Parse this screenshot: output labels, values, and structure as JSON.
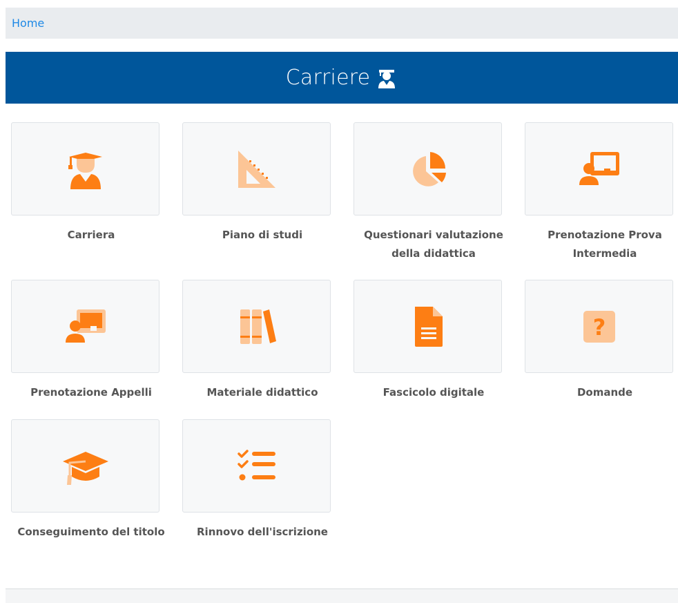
{
  "breadcrumb": {
    "home": "Home"
  },
  "header": {
    "title": "Carriere",
    "icon": "graduate-student-icon"
  },
  "colors": {
    "accent": "#fd7e14",
    "accent_light": "#fcc596",
    "header": "#00569b",
    "link": "#1e88e5"
  },
  "tiles": [
    {
      "label": "Carriera",
      "icon": "graduate-student-icon"
    },
    {
      "label": "Piano di studi",
      "icon": "set-square-icon"
    },
    {
      "label": "Questionari valutazione della didattica",
      "icon": "pie-chart-icon"
    },
    {
      "label": "Prenotazione Prova Intermedia",
      "icon": "teacher-board-icon"
    },
    {
      "label": "Prenotazione Appelli",
      "icon": "teacher-board-light-icon"
    },
    {
      "label": "Materiale didattico",
      "icon": "books-icon"
    },
    {
      "label": "Fascicolo digitale",
      "icon": "document-icon"
    },
    {
      "label": "Domande",
      "icon": "question-icon"
    },
    {
      "label": "Conseguimento del titolo",
      "icon": "graduation-cap-icon"
    },
    {
      "label": "Rinnovo dell'iscrizione",
      "icon": "checklist-icon"
    }
  ]
}
